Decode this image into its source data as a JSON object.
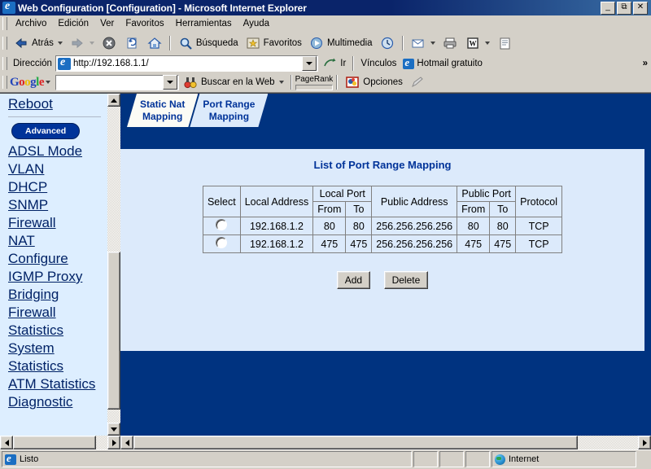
{
  "window": {
    "title": "Web Configuration [Configuration] - Microsoft Internet Explorer",
    "icon": "ie-icon",
    "minimize_label": "_",
    "restore_label": "❐",
    "close_label": "✕"
  },
  "menubar": {
    "items": [
      {
        "label": "Archivo"
      },
      {
        "label": "Edición"
      },
      {
        "label": "Ver"
      },
      {
        "label": "Favoritos"
      },
      {
        "label": "Herramientas"
      },
      {
        "label": "Ayuda"
      }
    ]
  },
  "toolbar": {
    "back_label": "Atrás",
    "search_label": "Búsqueda",
    "favorites_label": "Favoritos",
    "multimedia_label": "Multimedia"
  },
  "addressbar": {
    "label": "Dirección",
    "value": "http://192.168.1.1/",
    "placeholder": "",
    "go_label": "Ir",
    "links_label": "Vínculos",
    "hotmail_label": "Hotmail gratuito",
    "chevron_label": "»"
  },
  "googlebar": {
    "logo": {
      "g1": "G",
      "o1": "o",
      "o2": "o",
      "g2": "g",
      "l": "l",
      "e": "e"
    },
    "search_value": "",
    "search_placeholder": "",
    "search_web_label": "Buscar en la Web",
    "pagerank_label": "PageRank",
    "options_label": "Opciones"
  },
  "sidebar": {
    "items": [
      {
        "label": "Reboot",
        "type": "link",
        "name": "sidebar-item-reboot"
      },
      {
        "label": "Advanced",
        "type": "badge",
        "name": "sidebar-badge-advanced"
      },
      {
        "label": "ADSL Mode",
        "type": "link",
        "name": "sidebar-item-adsl-mode"
      },
      {
        "label": "VLAN",
        "type": "link",
        "name": "sidebar-item-vlan"
      },
      {
        "label": "DHCP",
        "type": "link",
        "name": "sidebar-item-dhcp"
      },
      {
        "label": "SNMP",
        "type": "link",
        "name": "sidebar-item-snmp"
      },
      {
        "label": "Firewall",
        "type": "link",
        "name": "sidebar-item-firewall"
      },
      {
        "label": "NAT",
        "type": "link",
        "name": "sidebar-item-nat"
      },
      {
        "label": "Configure",
        "type": "link",
        "name": "sidebar-item-configure"
      },
      {
        "label": "IGMP Proxy",
        "type": "link",
        "name": "sidebar-item-igmp-proxy"
      },
      {
        "label": "Bridging",
        "type": "link",
        "name": "sidebar-item-bridging"
      },
      {
        "label": "Firewall Statistics",
        "type": "link",
        "name": "sidebar-item-firewall-statistics"
      },
      {
        "label": "System Statistics",
        "type": "link",
        "name": "sidebar-item-system-statistics"
      },
      {
        "label": "ATM Statistics",
        "type": "link",
        "name": "sidebar-item-atm-statistics"
      },
      {
        "label": "Diagnostic",
        "type": "link",
        "name": "sidebar-item-diagnostic"
      }
    ]
  },
  "main": {
    "tabs": [
      {
        "label": "Static Nat Mapping",
        "line1": "Static Nat",
        "line2": "Mapping",
        "active": true
      },
      {
        "label": "Port Range Mapping",
        "line1": "Port Range",
        "line2": "Mapping",
        "active": false
      }
    ],
    "panel_title": "List of Port Range Mapping",
    "table": {
      "headers_group": {
        "select": "Select",
        "local_address": "Local Address",
        "local_port": "Local Port",
        "public_address": "Public Address",
        "public_port": "Public Port",
        "protocol": "Protocol"
      },
      "subheaders": {
        "local_from": "From",
        "local_to": "To",
        "public_from": "From",
        "public_to": "To"
      },
      "rows": [
        {
          "select": "",
          "local_address": "192.168.1.2",
          "local_port_from": "80",
          "local_port_to": "80",
          "public_address": "256.256.256.256",
          "public_port_from": "80",
          "public_port_to": "80",
          "protocol": "TCP"
        },
        {
          "select": "",
          "local_address": "192.168.1.2",
          "local_port_from": "475",
          "local_port_to": "475",
          "public_address": "256.256.256.256",
          "public_port_from": "475",
          "public_port_to": "475",
          "protocol": "TCP"
        }
      ]
    },
    "buttons": {
      "add_label": "Add",
      "delete_label": "Delete"
    }
  },
  "statusbar": {
    "status_text": "Listo",
    "zone_text": "Internet"
  },
  "colors": {
    "panel_bg": "#dceafb",
    "frame_bg": "#003380",
    "sidebar_bg": "#ddeeff",
    "link": "#002266",
    "accent": "#003399",
    "titlebar": "#0a246a",
    "chrome": "#d4d0c8"
  }
}
